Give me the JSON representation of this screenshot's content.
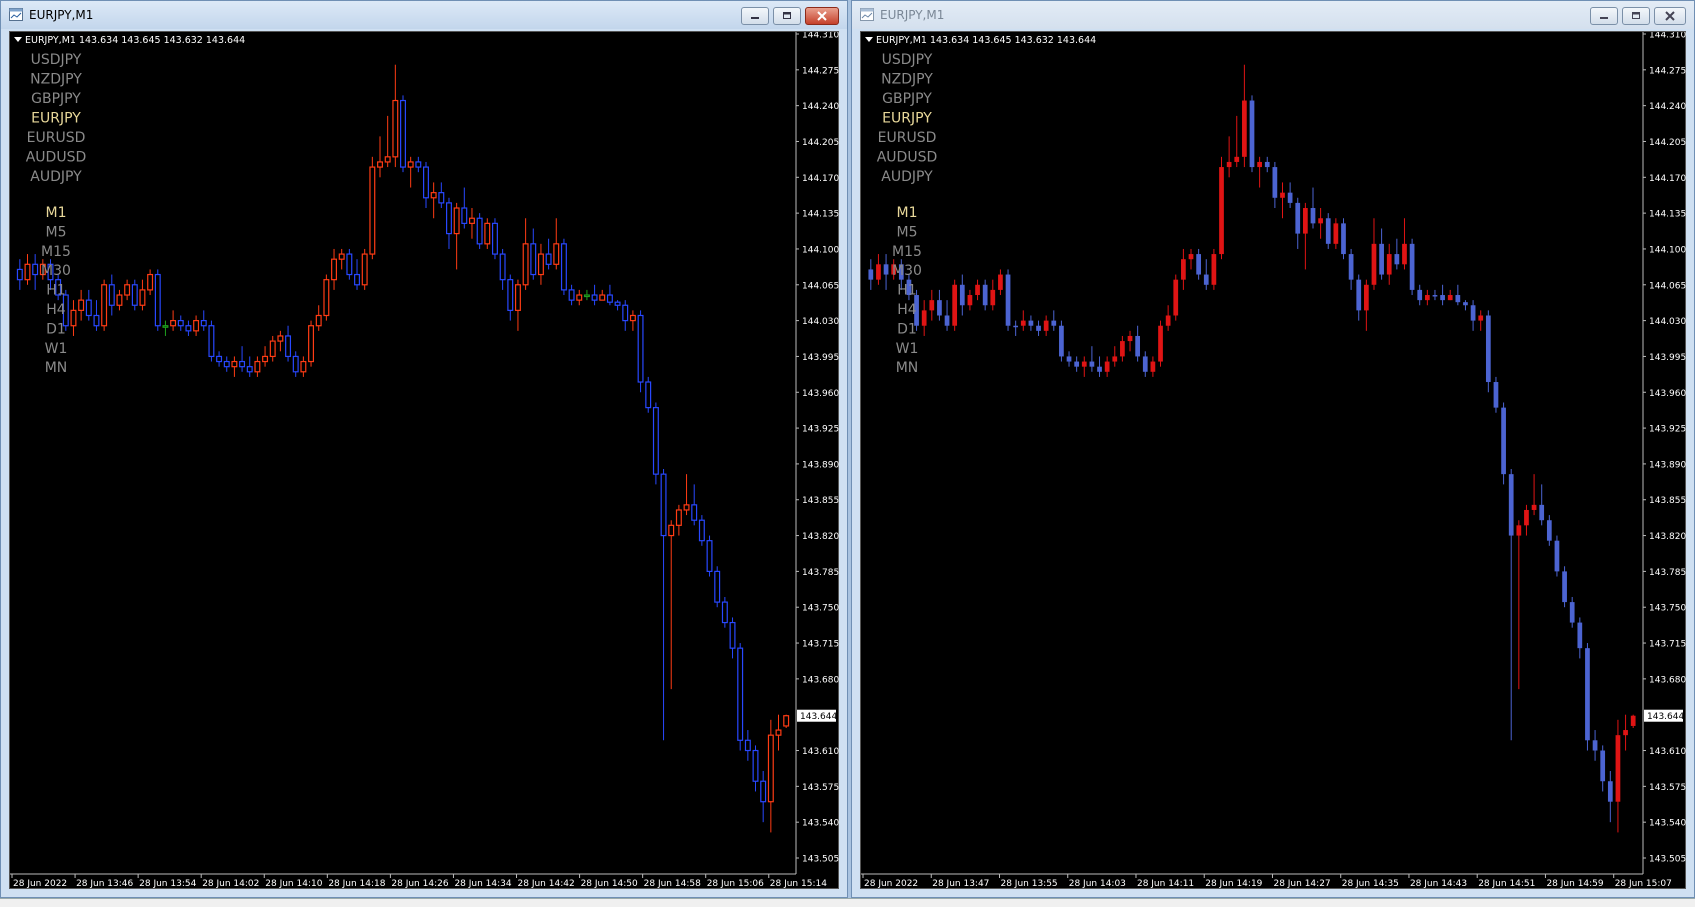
{
  "windows": [
    {
      "title": "EURJPY,M1",
      "active": true,
      "chart_header": "EURJPY,M1  143.634 143.645 143.632 143.644",
      "current_price": "143.644",
      "price_ticks": [
        "144.310",
        "144.275",
        "144.240",
        "144.205",
        "144.170",
        "144.135",
        "144.100",
        "144.065",
        "144.030",
        "143.995",
        "143.960",
        "143.925",
        "143.890",
        "143.855",
        "143.820",
        "143.785",
        "143.750",
        "143.715",
        "143.680",
        "143.644",
        "143.610",
        "143.575",
        "143.540",
        "143.505"
      ],
      "time_ticks": [
        "28 Jun 2022",
        "28 Jun 13:46",
        "28 Jun 13:54",
        "28 Jun 14:02",
        "28 Jun 14:10",
        "28 Jun 14:18",
        "28 Jun 14:26",
        "28 Jun 14:34",
        "28 Jun 14:42",
        "28 Jun 14:50",
        "28 Jun 14:58",
        "28 Jun 15:06",
        "28 Jun 15:14"
      ],
      "colors": {
        "bull": "#ff3c14",
        "bear": "#2848ff",
        "doji": "#1ea01e",
        "background": "#000000",
        "text": "#ffffff",
        "axis": "#8a8a8a"
      }
    },
    {
      "title": "EURJPY,M1",
      "active": false,
      "chart_header": "EURJPY,M1  143.634 143.645 143.632 143.644",
      "current_price": "143.644",
      "price_ticks": [
        "144.310",
        "144.275",
        "144.240",
        "144.205",
        "144.170",
        "144.135",
        "144.100",
        "144.065",
        "144.030",
        "143.995",
        "143.960",
        "143.925",
        "143.890",
        "143.855",
        "143.820",
        "143.785",
        "143.750",
        "143.715",
        "143.680",
        "143.644",
        "143.610",
        "143.575",
        "143.540",
        "143.505"
      ],
      "time_ticks": [
        "28 Jun 2022",
        "28 Jun 13:47",
        "28 Jun 13:55",
        "28 Jun 14:03",
        "28 Jun 14:11",
        "28 Jun 14:19",
        "28 Jun 14:27",
        "28 Jun 14:35",
        "28 Jun 14:43",
        "28 Jun 14:51",
        "28 Jun 14:59",
        "28 Jun 15:07"
      ],
      "colors": {
        "bull": "#e01414",
        "bear": "#4c64d2",
        "doji": "#4c64d2",
        "background": "#000000",
        "text": "#ffffff",
        "axis": "#8a8a8a"
      }
    }
  ],
  "symbol_menu": {
    "symbols": [
      "USDJPY",
      "NZDJPY",
      "GBPJPY",
      "EURJPY",
      "EURUSD",
      "AUDUSD",
      "AUDJPY"
    ],
    "active_symbol": "EURJPY",
    "timeframes": [
      "M1",
      "M5",
      "M15",
      "M30",
      "H1",
      "H4",
      "D1",
      "W1",
      "MN"
    ],
    "active_timeframe": "M1",
    "active_color": "#e8d89a",
    "inactive_color": "#8a8a8a"
  },
  "icons": {
    "window": "chart-window-icon",
    "minimize": "minimize-icon",
    "maximize": "maximize-icon",
    "close": "close-icon",
    "dropdown": "triangle-down-icon"
  },
  "chart_data": {
    "type": "candlestick",
    "symbol": "EURJPY",
    "timeframe": "M1",
    "ylim": [
      143.505,
      144.31
    ],
    "candles": [
      [
        144.08,
        144.09,
        144.06,
        144.07
      ],
      [
        144.07,
        144.095,
        144.065,
        144.085
      ],
      [
        144.085,
        144.095,
        144.06,
        144.075
      ],
      [
        144.075,
        144.09,
        144.07,
        144.085
      ],
      [
        144.085,
        144.09,
        144.06,
        144.07
      ],
      [
        144.07,
        144.075,
        144.05,
        144.055
      ],
      [
        144.055,
        144.06,
        144.02,
        144.025
      ],
      [
        144.025,
        144.05,
        144.015,
        144.04
      ],
      [
        144.04,
        144.06,
        144.03,
        144.05
      ],
      [
        144.05,
        144.06,
        144.03,
        144.035
      ],
      [
        144.035,
        144.05,
        144.02,
        144.025
      ],
      [
        144.025,
        144.07,
        144.02,
        144.065
      ],
      [
        144.065,
        144.075,
        144.035,
        144.045
      ],
      [
        144.045,
        144.06,
        144.04,
        144.055
      ],
      [
        144.055,
        144.07,
        144.05,
        144.065
      ],
      [
        144.065,
        144.07,
        144.04,
        144.045
      ],
      [
        144.045,
        144.07,
        144.04,
        144.06
      ],
      [
        144.06,
        144.08,
        144.055,
        144.075
      ],
      [
        144.075,
        144.08,
        144.02,
        144.025
      ],
      [
        144.025,
        144.03,
        144.015,
        144.025
      ],
      [
        144.025,
        144.04,
        144.02,
        144.03
      ],
      [
        144.03,
        144.035,
        144.02,
        144.025
      ],
      [
        144.025,
        144.03,
        144.015,
        144.02
      ],
      [
        144.02,
        144.035,
        144.015,
        144.03
      ],
      [
        144.03,
        144.04,
        144.02,
        144.025
      ],
      [
        144.025,
        144.03,
        143.99,
        143.995
      ],
      [
        143.995,
        144.0,
        143.985,
        143.99
      ],
      [
        143.99,
        143.995,
        143.98,
        143.985
      ],
      [
        143.985,
        143.995,
        143.975,
        143.99
      ],
      [
        143.99,
        144.005,
        143.98,
        143.985
      ],
      [
        143.985,
        143.995,
        143.975,
        143.98
      ],
      [
        143.98,
        143.995,
        143.975,
        143.99
      ],
      [
        143.99,
        144.005,
        143.985,
        143.995
      ],
      [
        143.995,
        144.015,
        143.99,
        144.01
      ],
      [
        144.01,
        144.02,
        144.0,
        144.015
      ],
      [
        144.015,
        144.025,
        143.99,
        143.995
      ],
      [
        143.995,
        144.0,
        143.975,
        143.98
      ],
      [
        143.98,
        143.995,
        143.975,
        143.99
      ],
      [
        143.99,
        144.03,
        143.985,
        144.025
      ],
      [
        144.025,
        144.045,
        144.02,
        144.035
      ],
      [
        144.035,
        144.075,
        144.03,
        144.07
      ],
      [
        144.07,
        144.1,
        144.06,
        144.09
      ],
      [
        144.09,
        144.1,
        144.08,
        144.095
      ],
      [
        144.095,
        144.1,
        144.07,
        144.075
      ],
      [
        144.075,
        144.09,
        144.06,
        144.065
      ],
      [
        144.065,
        144.1,
        144.06,
        144.095
      ],
      [
        144.095,
        144.19,
        144.09,
        144.18
      ],
      [
        144.18,
        144.21,
        144.17,
        144.185
      ],
      [
        144.185,
        144.23,
        144.18,
        144.19
      ],
      [
        144.19,
        144.28,
        144.18,
        144.245
      ],
      [
        144.245,
        144.25,
        144.175,
        144.18
      ],
      [
        144.18,
        144.19,
        144.16,
        144.185
      ],
      [
        144.185,
        144.19,
        144.175,
        144.18
      ],
      [
        144.18,
        144.185,
        144.14,
        144.15
      ],
      [
        144.15,
        144.165,
        144.13,
        144.155
      ],
      [
        144.155,
        144.165,
        144.14,
        144.145
      ],
      [
        144.145,
        144.15,
        144.1,
        144.115
      ],
      [
        144.115,
        144.145,
        144.08,
        144.14
      ],
      [
        144.14,
        144.16,
        144.12,
        144.125
      ],
      [
        144.125,
        144.14,
        144.11,
        144.13
      ],
      [
        144.13,
        144.135,
        144.1,
        144.105
      ],
      [
        144.105,
        144.13,
        144.1,
        144.125
      ],
      [
        144.125,
        144.13,
        144.09,
        144.095
      ],
      [
        144.095,
        144.1,
        144.06,
        144.07
      ],
      [
        144.07,
        144.075,
        144.03,
        144.04
      ],
      [
        144.04,
        144.07,
        144.02,
        144.065
      ],
      [
        144.065,
        144.13,
        144.06,
        144.105
      ],
      [
        144.105,
        144.12,
        144.07,
        144.075
      ],
      [
        144.075,
        144.105,
        144.065,
        144.095
      ],
      [
        144.095,
        144.11,
        144.08,
        144.085
      ],
      [
        144.085,
        144.13,
        144.08,
        144.105
      ],
      [
        144.105,
        144.11,
        144.055,
        144.06
      ],
      [
        144.06,
        144.065,
        144.045,
        144.05
      ],
      [
        144.05,
        144.06,
        144.045,
        144.055
      ],
      [
        144.055,
        144.06,
        144.05,
        144.055
      ],
      [
        144.055,
        144.065,
        144.045,
        144.05
      ],
      [
        144.05,
        144.06,
        144.05,
        144.055
      ],
      [
        144.055,
        144.065,
        144.045,
        144.048
      ],
      [
        144.048,
        144.05,
        144.04,
        144.045
      ],
      [
        144.045,
        144.05,
        144.02,
        144.03
      ],
      [
        144.03,
        144.04,
        144.02,
        144.035
      ],
      [
        144.035,
        144.04,
        143.96,
        143.97
      ],
      [
        143.97,
        143.975,
        143.94,
        143.945
      ],
      [
        143.945,
        143.95,
        143.87,
        143.88
      ],
      [
        143.88,
        143.885,
        143.62,
        143.82
      ],
      [
        143.82,
        143.835,
        143.67,
        143.83
      ],
      [
        143.83,
        143.85,
        143.82,
        143.845
      ],
      [
        143.845,
        143.88,
        143.84,
        143.85
      ],
      [
        143.85,
        143.87,
        143.83,
        143.835
      ],
      [
        143.835,
        143.84,
        143.81,
        143.815
      ],
      [
        143.815,
        143.82,
        143.78,
        143.785
      ],
      [
        143.785,
        143.79,
        143.75,
        143.755
      ],
      [
        143.755,
        143.76,
        143.73,
        143.735
      ],
      [
        143.735,
        143.74,
        143.7,
        143.71
      ],
      [
        143.71,
        143.715,
        143.61,
        143.62
      ],
      [
        143.62,
        143.63,
        143.6,
        143.61
      ],
      [
        143.61,
        143.615,
        143.57,
        143.58
      ],
      [
        143.58,
        143.59,
        143.54,
        143.56
      ],
      [
        143.56,
        143.64,
        143.53,
        143.625
      ],
      [
        143.625,
        143.645,
        143.61,
        143.63
      ],
      [
        143.634,
        143.645,
        143.632,
        143.644
      ]
    ]
  }
}
